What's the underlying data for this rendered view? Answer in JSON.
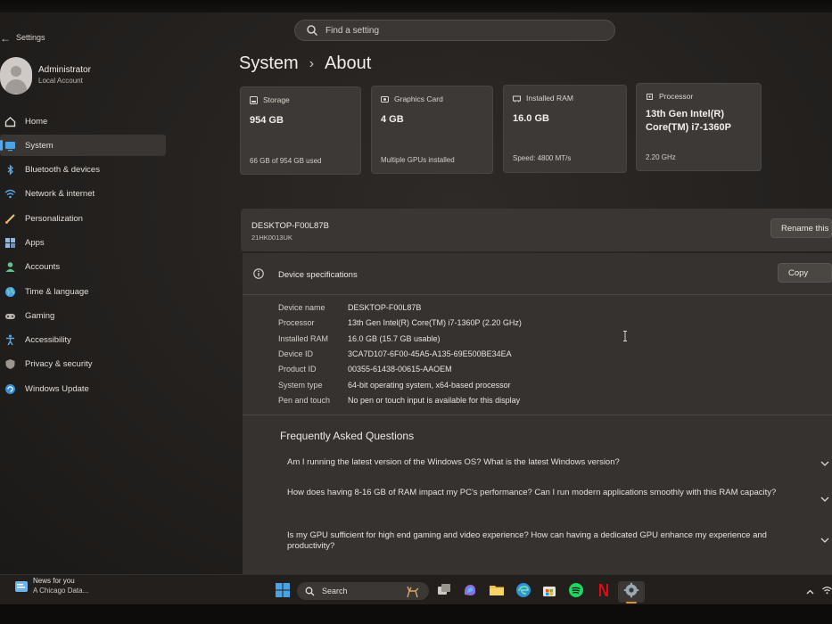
{
  "window": {
    "title": "Settings"
  },
  "search": {
    "placeholder": "Find a setting"
  },
  "account": {
    "name": "Administrator",
    "type": "Local Account"
  },
  "sidebar": {
    "items": [
      {
        "label": "Home",
        "icon": "home-icon"
      },
      {
        "label": "System",
        "icon": "monitor-icon",
        "active": true
      },
      {
        "label": "Bluetooth & devices",
        "icon": "bluetooth-icon"
      },
      {
        "label": "Network & internet",
        "icon": "wifi-icon"
      },
      {
        "label": "Personalization",
        "icon": "brush-icon"
      },
      {
        "label": "Apps",
        "icon": "apps-icon"
      },
      {
        "label": "Accounts",
        "icon": "person-icon"
      },
      {
        "label": "Time & language",
        "icon": "globe-icon"
      },
      {
        "label": "Gaming",
        "icon": "gamepad-icon"
      },
      {
        "label": "Accessibility",
        "icon": "accessibility-icon"
      },
      {
        "label": "Privacy & security",
        "icon": "shield-icon"
      },
      {
        "label": "Windows Update",
        "icon": "update-icon"
      }
    ]
  },
  "breadcrumb": {
    "parent": "System",
    "current": "About"
  },
  "cards": {
    "storage": {
      "label": "Storage",
      "value": "954 GB",
      "sub": "66 GB of 954 GB used"
    },
    "graphics": {
      "label": "Graphics Card",
      "value": "4 GB",
      "sub": "Multiple GPUs installed"
    },
    "ram": {
      "label": "Installed RAM",
      "value": "16.0 GB",
      "sub": "Speed: 4800 MT/s"
    },
    "processor": {
      "label": "Processor",
      "value_line1": "13th Gen Intel(R)",
      "value_line2": "Core(TM) i7-1360P",
      "sub": "2.20 GHz"
    }
  },
  "device": {
    "name": "DESKTOP-F00L87B",
    "model": "21HK0013UK",
    "rename_label": "Rename this"
  },
  "specs": {
    "title": "Device specifications",
    "copy_label": "Copy",
    "rows": [
      {
        "key": "Device name",
        "value": "DESKTOP-F00L87B"
      },
      {
        "key": "Processor",
        "value": "13th Gen Intel(R) Core(TM) i7-1360P (2.20 GHz)"
      },
      {
        "key": "Installed RAM",
        "value": "16.0 GB (15.7 GB usable)"
      },
      {
        "key": "Device ID",
        "value": "3CA7D107-6F00-45A5-A135-69E500BE34EA"
      },
      {
        "key": "Product ID",
        "value": "00355-61438-00615-AAOEM"
      },
      {
        "key": "System type",
        "value": "64-bit operating system, x64-based processor"
      },
      {
        "key": "Pen and touch",
        "value": "No pen or touch input is available for this display"
      }
    ]
  },
  "faq": {
    "title": "Frequently Asked Questions",
    "items": [
      "Am I running the latest version of the Windows OS? What is the latest Windows version?",
      "How does having 8-16 GB of RAM impact my PC's performance? Can I run modern applications smoothly with this RAM capacity?",
      "Is my GPU sufficient for high end gaming and video experience? How can having a dedicated GPU enhance my experience and productivity?"
    ]
  },
  "taskbar": {
    "news_title": "News for you",
    "news_sub": "A Chicago Data...",
    "search_label": "Search",
    "accent": "#e58c3a"
  }
}
